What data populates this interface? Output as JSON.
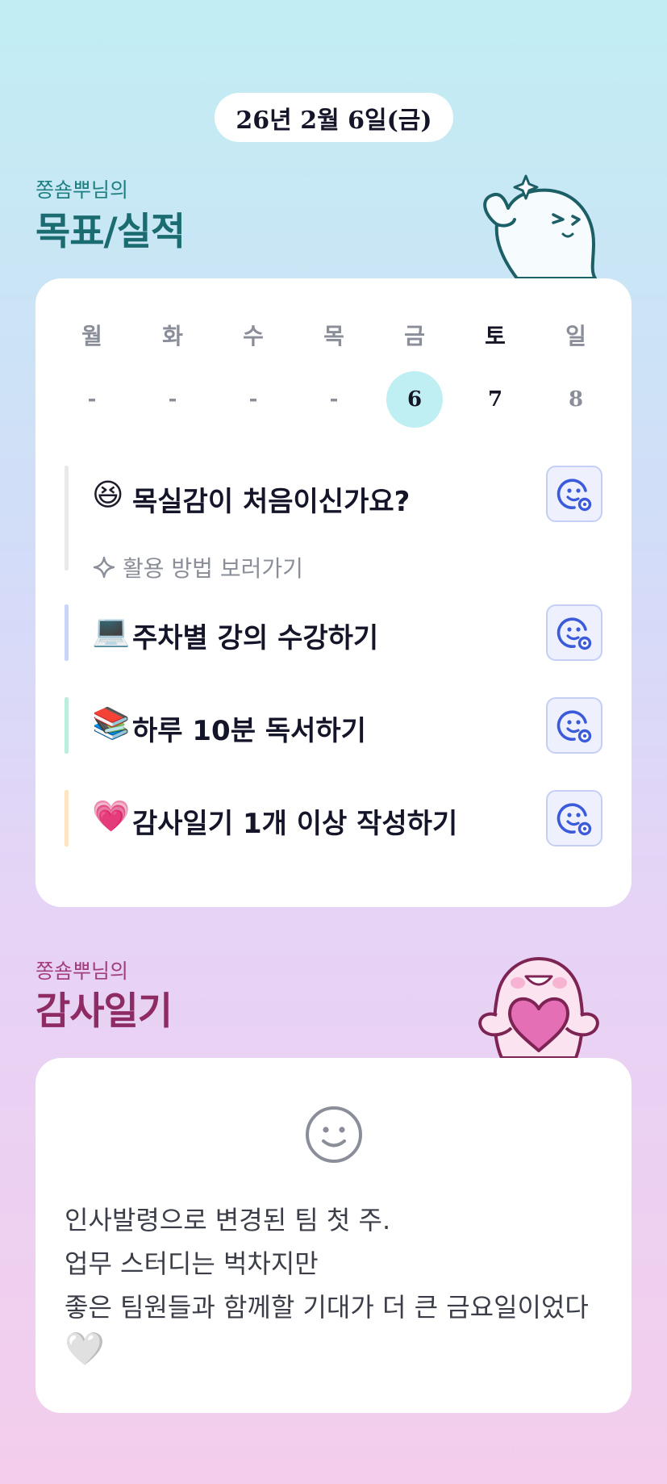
{
  "header": {
    "date": "26년 2월 6일(금)"
  },
  "goals_section": {
    "owner_label": "쫑숌뿌님의",
    "title": "목표/실적"
  },
  "week": {
    "days": [
      "월",
      "화",
      "수",
      "목",
      "금",
      "토",
      "일"
    ],
    "dates": [
      "-",
      "-",
      "-",
      "-",
      "6",
      "7",
      "8"
    ],
    "selected_index": 4
  },
  "goals": [
    {
      "emoji": "😆",
      "label": "목실감이 처음이신가요?",
      "hint": "활용 방법 보러가기",
      "bar_color": "#e9e9ec"
    },
    {
      "emoji": "💻",
      "label": "주차별 강의 수강하기",
      "bar_color": "#c9d4f7"
    },
    {
      "emoji": "📚",
      "label": "하루 10분 독서하기",
      "bar_color": "#bdeedd"
    },
    {
      "emoji": "💗",
      "label": "감사일기 1개 이상 작성하기",
      "bar_color": "#fde4c3"
    }
  ],
  "diary_section": {
    "owner_label": "쫑숌뿌님의",
    "title": "감사일기"
  },
  "diary": {
    "lines": [
      "인사발령으로 변경된 팀 첫 주.",
      "업무 스터디는 벅차지만",
      "좋은 팀원들과 함께할 기대가 더 큰 금요일이었다"
    ],
    "emoji": "🤍"
  },
  "colors": {
    "teal_title": "#1b6c70",
    "pink_title": "#8e2a64",
    "accent_blue": "#3b5bdb"
  }
}
